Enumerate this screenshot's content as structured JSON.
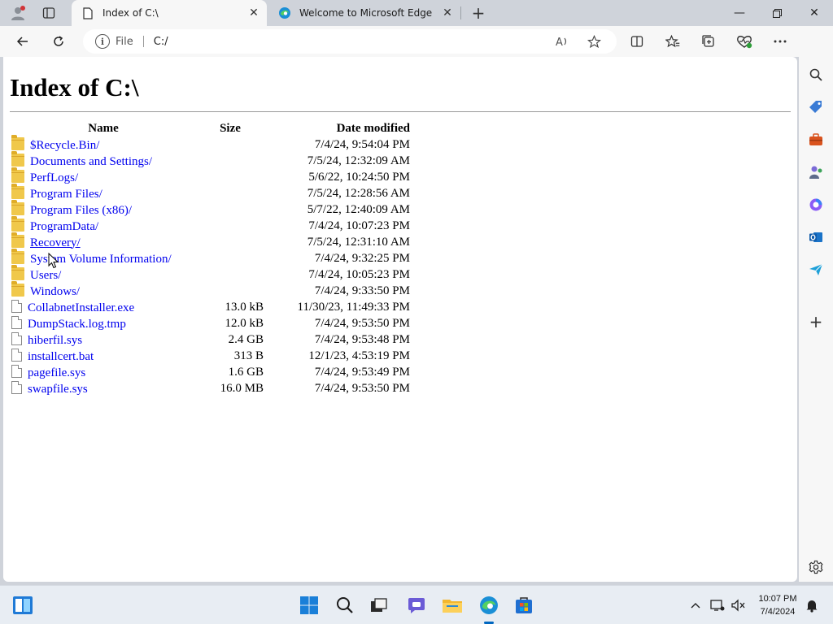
{
  "tabs": [
    {
      "title": "Index of C:\\",
      "icon": "page-icon",
      "active": true
    },
    {
      "title": "Welcome to Microsoft Edge",
      "icon": "edge-icon",
      "active": false
    }
  ],
  "address": {
    "scheme": "File",
    "url": "C:/"
  },
  "page": {
    "heading": "Index of C:\\",
    "columns": {
      "name": "Name",
      "size": "Size",
      "date": "Date modified"
    },
    "entries": [
      {
        "name": "$Recycle.Bin/",
        "type": "folder",
        "size": "",
        "date": "7/4/24, 9:54:04 PM"
      },
      {
        "name": "Documents and Settings/",
        "type": "folder",
        "size": "",
        "date": "7/5/24, 12:32:09 AM"
      },
      {
        "name": "PerfLogs/",
        "type": "folder",
        "size": "",
        "date": "5/6/22, 10:24:50 PM"
      },
      {
        "name": "Program Files/",
        "type": "folder",
        "size": "",
        "date": "7/5/24, 12:28:56 AM"
      },
      {
        "name": "Program Files (x86)/",
        "type": "folder",
        "size": "",
        "date": "5/7/22, 12:40:09 AM"
      },
      {
        "name": "ProgramData/",
        "type": "folder",
        "size": "",
        "date": "7/4/24, 10:07:23 PM"
      },
      {
        "name": "Recovery/",
        "type": "folder",
        "size": "",
        "date": "7/5/24, 12:31:10 AM"
      },
      {
        "name": "System Volume Information/",
        "type": "folder",
        "size": "",
        "date": "7/4/24, 9:32:25 PM"
      },
      {
        "name": "Users/",
        "type": "folder",
        "size": "",
        "date": "7/4/24, 10:05:23 PM"
      },
      {
        "name": "Windows/",
        "type": "folder",
        "size": "",
        "date": "7/4/24, 9:33:50 PM"
      },
      {
        "name": "CollabnetInstaller.exe",
        "type": "file",
        "size": "13.0 kB",
        "date": "11/30/23, 11:49:33 PM"
      },
      {
        "name": "DumpStack.log.tmp",
        "type": "file",
        "size": "12.0 kB",
        "date": "7/4/24, 9:53:50 PM"
      },
      {
        "name": "hiberfil.sys",
        "type": "file",
        "size": "2.4 GB",
        "date": "7/4/24, 9:53:48 PM"
      },
      {
        "name": "installcert.bat",
        "type": "file",
        "size": "313 B",
        "date": "12/1/23, 4:53:19 PM"
      },
      {
        "name": "pagefile.sys",
        "type": "file",
        "size": "1.6 GB",
        "date": "7/4/24, 9:53:49 PM"
      },
      {
        "name": "swapfile.sys",
        "type": "file",
        "size": "16.0 MB",
        "date": "7/4/24, 9:53:50 PM"
      }
    ]
  },
  "taskbar": {
    "apps": [
      "start-icon",
      "search-icon",
      "task-view-icon",
      "chat-icon",
      "file-explorer-icon",
      "edge-icon",
      "store-icon"
    ],
    "clock": {
      "time": "10:07 PM",
      "date": "7/4/2024"
    }
  },
  "colors": {
    "link": "#0000ee",
    "folder": "#f0c84b",
    "accent": "#0067c0"
  }
}
